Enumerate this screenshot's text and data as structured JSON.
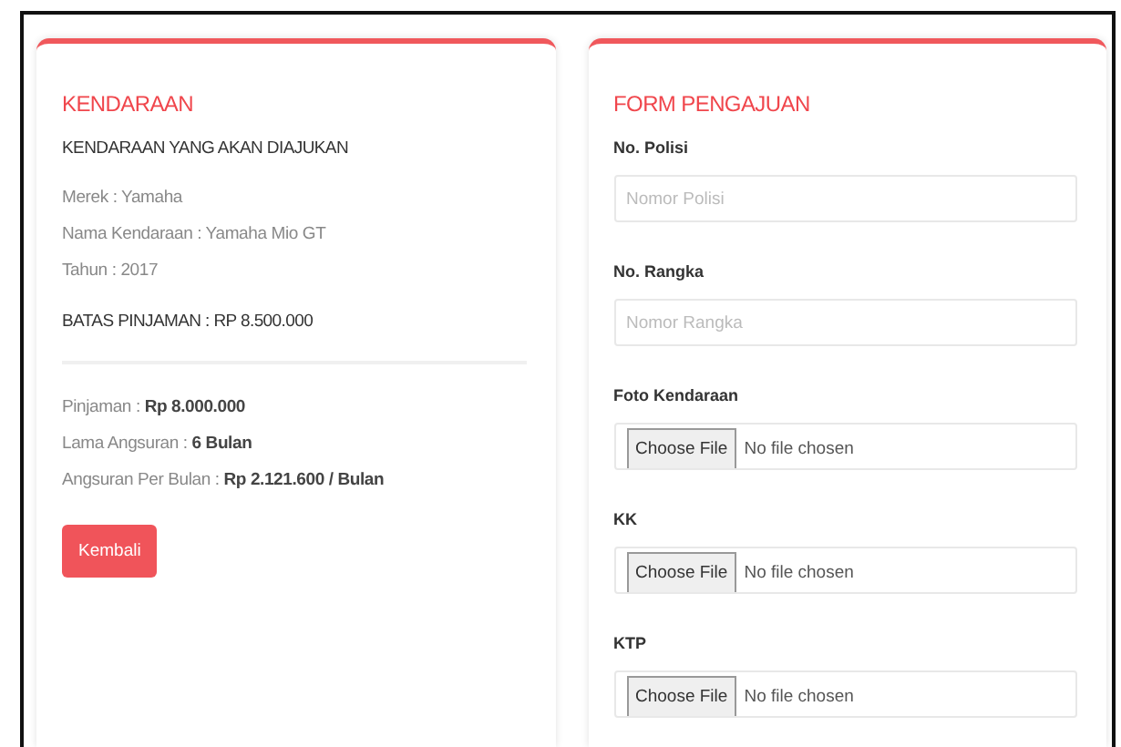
{
  "vehicle_card": {
    "title": "KENDARAAN",
    "subtitle": "KENDARAAN YANG AKAN DIAJUKAN",
    "details": [
      "Merek : Yamaha",
      "Nama Kendaraan : Yamaha Mio GT",
      "Tahun : 2017"
    ],
    "limit": "BATAS PINJAMAN : RP 8.500.000",
    "loan": [
      "Pinjaman : **Rp 8.000.000**",
      "Lama Angsuran : **6 Bulan**",
      "Angsuran Per Bulan : **Rp 2.121.600 / Bulan**"
    ],
    "button": "Kembali"
  },
  "form_card": {
    "title": "FORM PENGAJUAN",
    "fields": [
      {
        "kind": "text",
        "label": "No. Polisi",
        "placeholder": "Nomor Polisi"
      },
      {
        "kind": "text",
        "label": "No. Rangka",
        "placeholder": "Nomor Rangka"
      },
      {
        "kind": "file",
        "label": "Foto Kendaraan",
        "button": "Choose File",
        "status": "No file chosen"
      },
      {
        "kind": "file",
        "label": "KK",
        "button": "Choose File",
        "status": "No file chosen"
      },
      {
        "kind": "file",
        "label": "KTP",
        "button": "Choose File",
        "status": "No file chosen"
      }
    ]
  }
}
